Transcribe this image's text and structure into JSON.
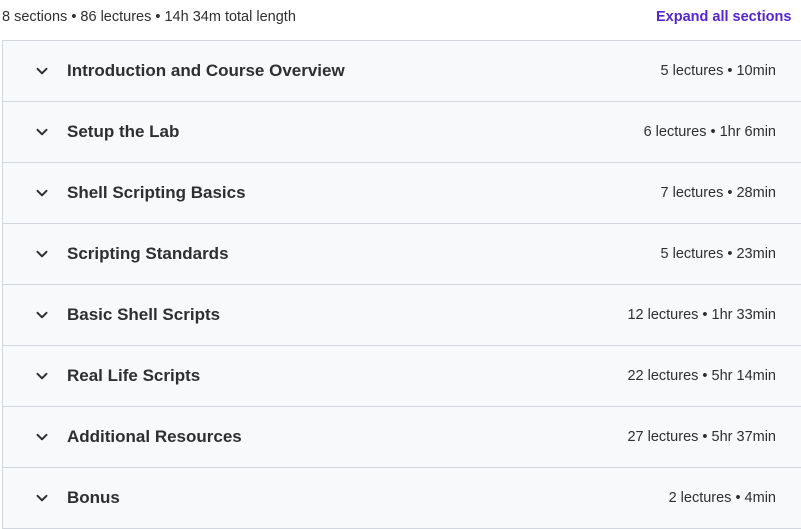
{
  "header": {
    "summary": "8 sections • 86 lectures • 14h 34m total length",
    "expand_label": "Expand all sections"
  },
  "sections": [
    {
      "title": "Introduction and Course Overview",
      "meta": "5 lectures • 10min",
      "icon": "chevron-down-icon"
    },
    {
      "title": "Setup the Lab",
      "meta": "6 lectures • 1hr 6min",
      "icon": "chevron-down-icon"
    },
    {
      "title": "Shell Scripting Basics",
      "meta": "7 lectures • 28min",
      "icon": "chevron-down-icon"
    },
    {
      "title": "Scripting Standards",
      "meta": "5 lectures • 23min",
      "icon": "chevron-down-icon"
    },
    {
      "title": "Basic Shell Scripts",
      "meta": "12 lectures • 1hr 33min",
      "icon": "chevron-down-icon"
    },
    {
      "title": "Real Life Scripts",
      "meta": "22 lectures • 5hr 14min",
      "icon": "chevron-down-icon"
    },
    {
      "title": "Additional Resources",
      "meta": "27 lectures • 5hr 37min",
      "icon": "chevron-down-icon"
    },
    {
      "title": "Bonus",
      "meta": "2 lectures • 4min",
      "icon": "chevron-down-icon"
    }
  ],
  "colors": {
    "accent": "#5624d0",
    "row_bg": "#f7f9fa",
    "border": "#d1d7dc",
    "text": "#2d2f31"
  }
}
